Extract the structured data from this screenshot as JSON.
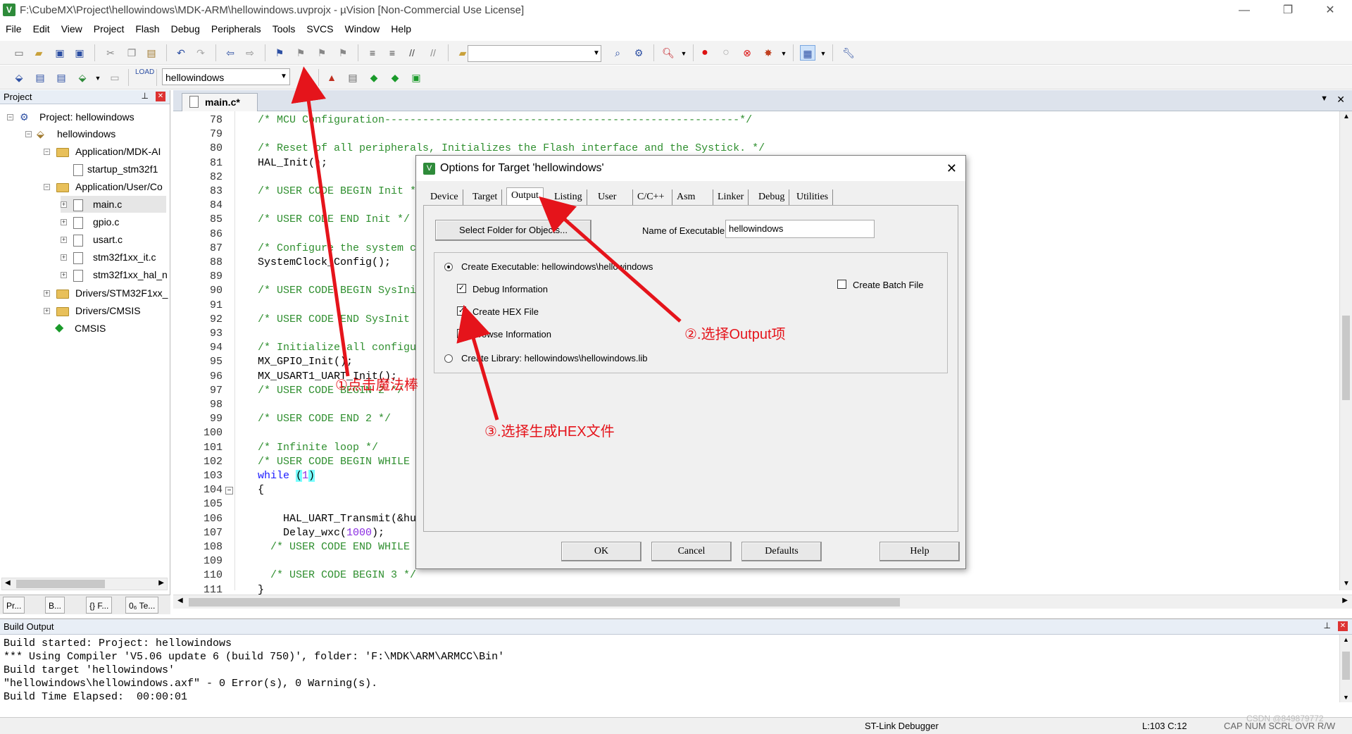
{
  "window": {
    "title": "F:\\CubeMX\\Project\\hellowindows\\MDK-ARM\\hellowindows.uvprojx - µVision  [Non-Commercial Use License]",
    "minimize": "—",
    "restore": "❐",
    "close": "✕"
  },
  "menu": [
    "File",
    "Edit",
    "View",
    "Project",
    "Flash",
    "Debug",
    "Peripherals",
    "Tools",
    "SVCS",
    "Window",
    "Help"
  ],
  "toolbar2": {
    "target_select": "hellowindows"
  },
  "project_panel": {
    "header": "Project",
    "tree": {
      "project": "Project: hellowindows",
      "target": "hellowindows",
      "group1": "Application/MDK-AI",
      "group1_file": "startup_stm32f1",
      "group2": "Application/User/Co",
      "files": [
        "main.c",
        "gpio.c",
        "usart.c",
        "stm32f1xx_it.c",
        "stm32f1xx_hal_n"
      ],
      "group3": "Drivers/STM32F1xx_",
      "group4": "Drivers/CMSIS",
      "cmsis": "CMSIS"
    },
    "bottom_tabs": [
      "Pr...",
      "B...",
      "{} F...",
      "0₆ Te..."
    ]
  },
  "editor": {
    "tab": "main.c*",
    "lines": [
      {
        "n": "78",
        "parts": [
          {
            "c": "cm",
            "t": "/* MCU Configuration--------------------------------------------------------*/"
          }
        ]
      },
      {
        "n": "79",
        "parts": []
      },
      {
        "n": "80",
        "parts": [
          {
            "c": "cm",
            "t": "/* Reset of all peripherals, Initializes the Flash interface and the Systick. */"
          }
        ]
      },
      {
        "n": "81",
        "parts": [
          {
            "c": "",
            "t": "HAL_Init();"
          }
        ]
      },
      {
        "n": "82",
        "parts": []
      },
      {
        "n": "83",
        "parts": [
          {
            "c": "cm",
            "t": "/* USER CODE BEGIN Init */"
          }
        ]
      },
      {
        "n": "84",
        "parts": []
      },
      {
        "n": "85",
        "parts": [
          {
            "c": "cm",
            "t": "/* USER CODE END Init */"
          }
        ]
      },
      {
        "n": "86",
        "parts": []
      },
      {
        "n": "87",
        "parts": [
          {
            "c": "cm",
            "t": "/* Configure the system clock */"
          }
        ]
      },
      {
        "n": "88",
        "parts": [
          {
            "c": "",
            "t": "SystemClock_Config();"
          }
        ]
      },
      {
        "n": "89",
        "parts": []
      },
      {
        "n": "90",
        "parts": [
          {
            "c": "cm",
            "t": "/* USER CODE BEGIN SysInit */"
          }
        ]
      },
      {
        "n": "91",
        "parts": []
      },
      {
        "n": "92",
        "parts": [
          {
            "c": "cm",
            "t": "/* USER CODE END SysInit */"
          }
        ]
      },
      {
        "n": "93",
        "parts": []
      },
      {
        "n": "94",
        "parts": [
          {
            "c": "cm",
            "t": "/* Initialize all configured peripherals */"
          }
        ]
      },
      {
        "n": "95",
        "parts": [
          {
            "c": "",
            "t": "MX_GPIO_Init();"
          }
        ]
      },
      {
        "n": "96",
        "parts": [
          {
            "c": "",
            "t": "MX_USART1_UART_Init();"
          }
        ]
      },
      {
        "n": "97",
        "parts": [
          {
            "c": "cm",
            "t": "/* USER CODE BEGIN 2 */"
          }
        ]
      },
      {
        "n": "98",
        "parts": []
      },
      {
        "n": "99",
        "parts": [
          {
            "c": "cm",
            "t": "/* USER CODE END 2 */"
          }
        ]
      },
      {
        "n": "100",
        "parts": []
      },
      {
        "n": "101",
        "parts": [
          {
            "c": "cm",
            "t": "/* Infinite loop */"
          }
        ]
      },
      {
        "n": "102",
        "parts": [
          {
            "c": "cm",
            "t": "/* USER CODE BEGIN WHILE */"
          }
        ]
      },
      {
        "n": "103",
        "parts": [
          {
            "c": "kw",
            "t": "while "
          },
          {
            "c": "hl",
            "t": "("
          },
          {
            "c": "num",
            "t": "1"
          },
          {
            "c": "hl",
            "t": ")"
          }
        ]
      },
      {
        "n": "104",
        "parts": [
          {
            "c": "",
            "t": "{"
          }
        ]
      },
      {
        "n": "105",
        "parts": []
      },
      {
        "n": "106",
        "parts": [
          {
            "c": "",
            "t": "    HAL_UART_Transmit(&huart1, (uint8_t *)\"hello windows!\\r\\n\", 16, 0xffff);"
          }
        ]
      },
      {
        "n": "107",
        "parts": [
          {
            "c": "",
            "t": "    Delay_wxc("
          },
          {
            "c": "num",
            "t": "1000"
          },
          {
            "c": "",
            "t": ");"
          }
        ]
      },
      {
        "n": "108",
        "parts": [
          {
            "c": "cm",
            "t": "  /* USER CODE END WHILE */"
          }
        ]
      },
      {
        "n": "109",
        "parts": []
      },
      {
        "n": "110",
        "parts": [
          {
            "c": "cm",
            "t": "  /* USER CODE BEGIN 3 */"
          }
        ]
      },
      {
        "n": "111",
        "parts": [
          {
            "c": "",
            "t": "}"
          }
        ]
      }
    ]
  },
  "dialog": {
    "title": "Options for Target 'hellowindows'",
    "tabs": [
      "Device",
      "Target",
      "Output",
      "Listing",
      "User",
      "C/C++",
      "Asm",
      "Linker",
      "Debug",
      "Utilities"
    ],
    "selected_tab": "Output",
    "select_folder": "Select Folder for Objects...",
    "name_exec_label": "Name of Executable:",
    "name_exec_value": "hellowindows",
    "create_exec": "Create Executable:  hellowindows\\hellowindows",
    "debug_info": "Debug Information",
    "create_hex": "Create HEX File",
    "browse_info": "Browse Information",
    "create_batch": "Create Batch File",
    "create_lib": "Create Library:  hellowindows\\hellowindows.lib",
    "ok": "OK",
    "cancel": "Cancel",
    "defaults": "Defaults",
    "help": "Help"
  },
  "annotations": {
    "a1": "①点击魔法棒",
    "a2": "②.选择Output项",
    "a3": "③.选择生成HEX文件",
    "color": "#e5141b"
  },
  "build_output": {
    "header": "Build Output",
    "lines": [
      "Build started: Project: hellowindows",
      "*** Using Compiler 'V5.06 update 6 (build 750)', folder: 'F:\\MDK\\ARM\\ARMCC\\Bin'",
      "Build target 'hellowindows'",
      "\"hellowindows\\hellowindows.axf\" - 0 Error(s), 0 Warning(s).",
      "Build Time Elapsed:  00:00:01"
    ]
  },
  "status": {
    "debugger": "ST-Link Debugger",
    "position": "L:103 C:12",
    "flags": "CAP  NUM  SCRL  OVR  R/W",
    "watermark": "CSDN @849879772"
  }
}
